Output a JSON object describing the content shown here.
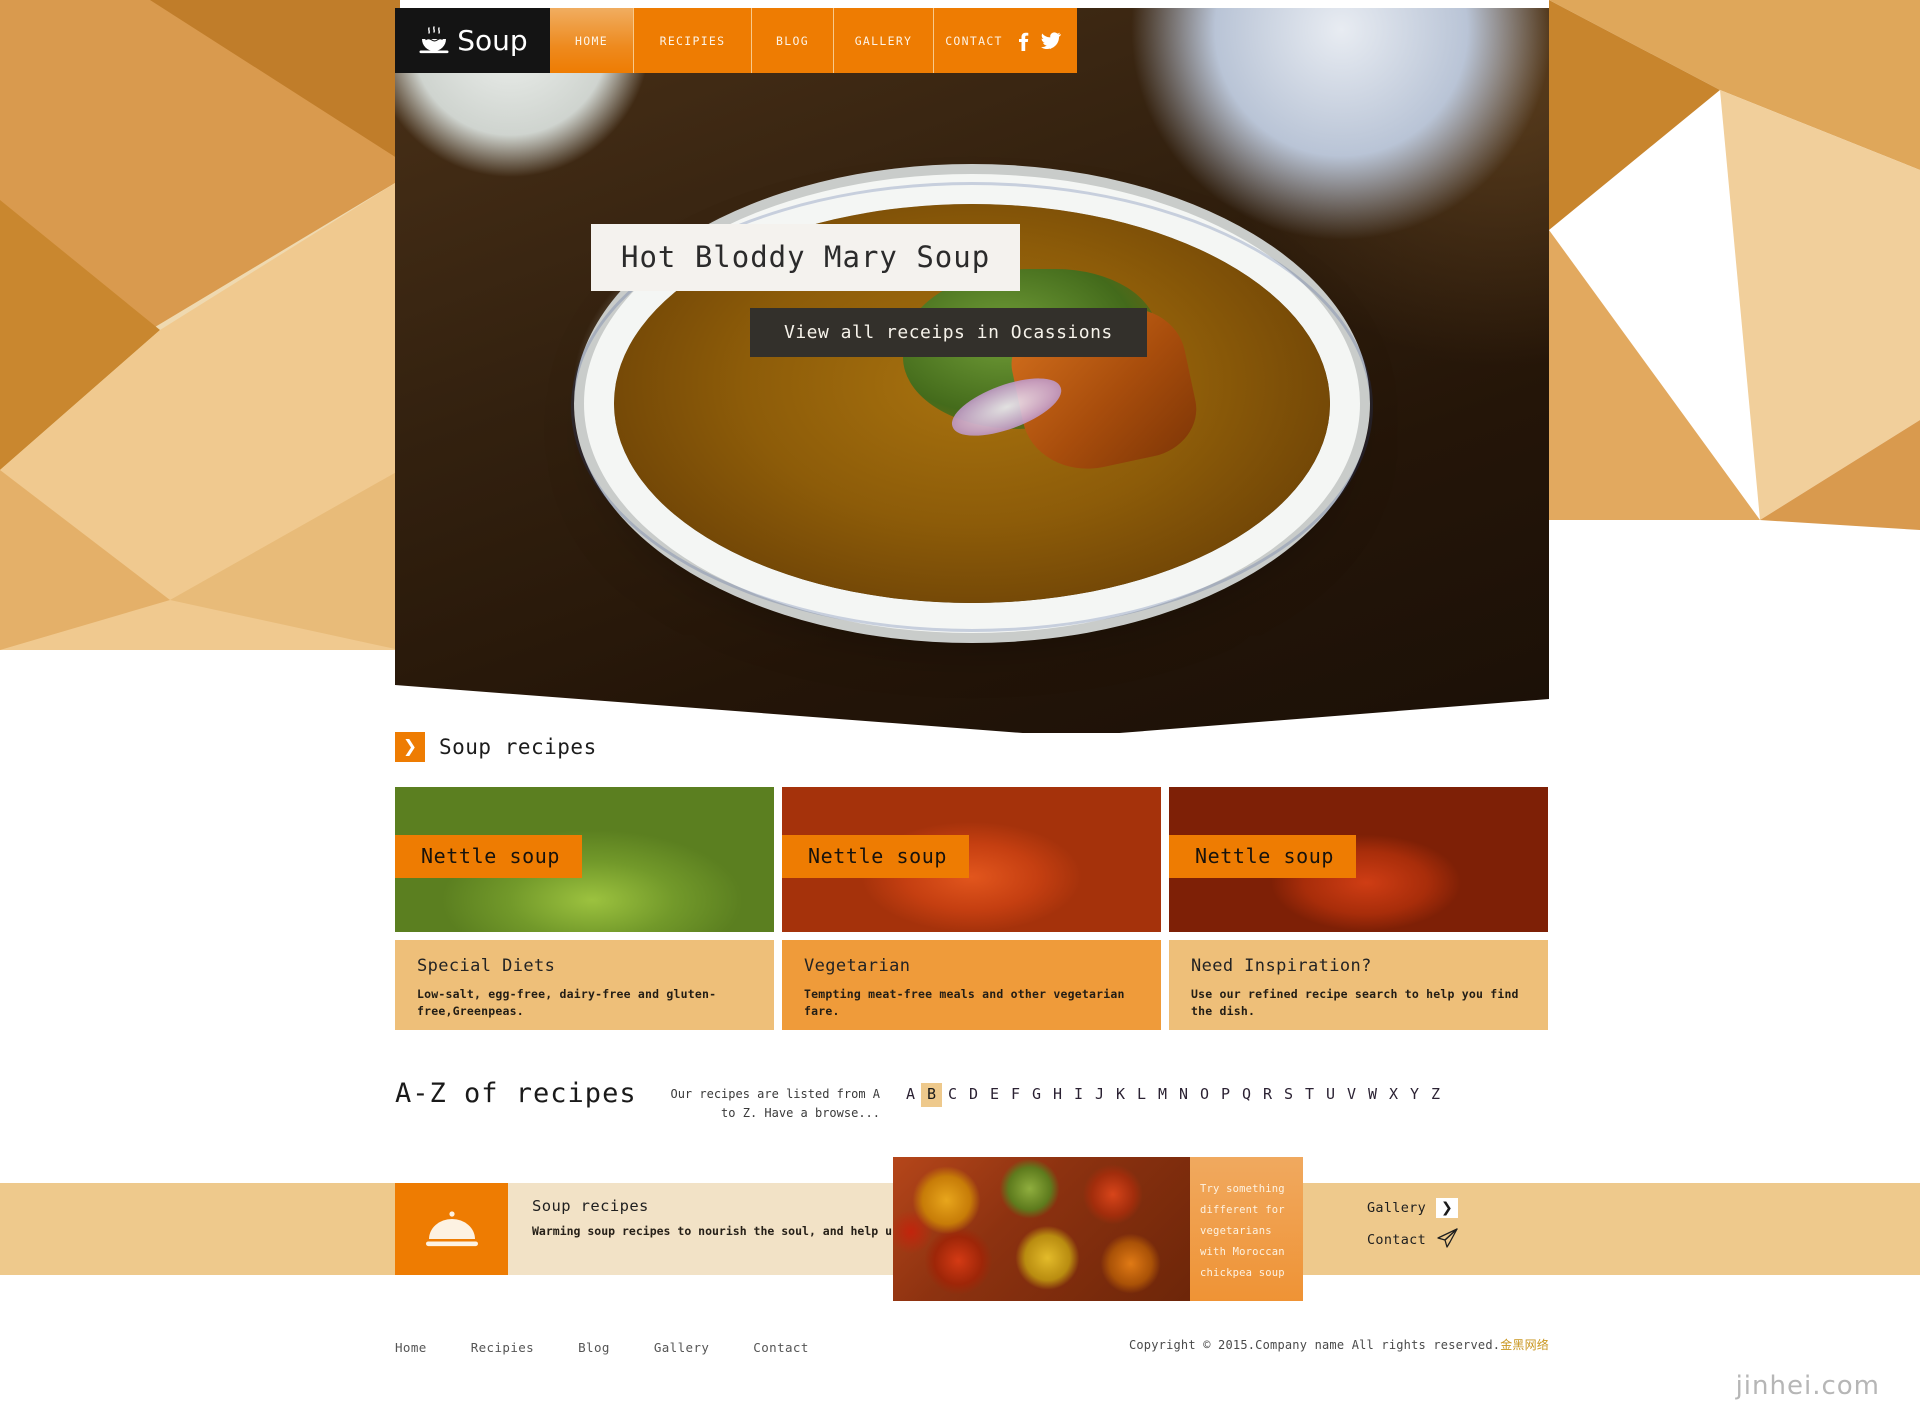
{
  "brand": {
    "name": "Soup",
    "icon": "soup-bowl-icon"
  },
  "nav": {
    "items": [
      {
        "label": "HOME",
        "key": "home"
      },
      {
        "label": "RECIPIES",
        "key": "recipies"
      },
      {
        "label": "BLOG",
        "key": "blog"
      },
      {
        "label": "GALLERY",
        "key": "gallery"
      },
      {
        "label": "CONTACT",
        "key": "contact"
      }
    ],
    "social": [
      {
        "name": "facebook-icon",
        "glyph": "f"
      },
      {
        "name": "twitter-icon",
        "glyph": "bird"
      }
    ]
  },
  "hero": {
    "title": "Hot Bloddy Mary Soup",
    "button": "View all receips in Ocassions"
  },
  "section": {
    "heading": "Soup recipes",
    "arrow_icon": "chevron-right-icon"
  },
  "cards": [
    {
      "label": "Nettle soup"
    },
    {
      "label": "Nettle soup"
    },
    {
      "label": "Nettle soup"
    }
  ],
  "infos": [
    {
      "title": "Special Diets",
      "text": "Low-salt, egg-free, dairy-free and gluten-free,Greenpeas."
    },
    {
      "title": "Vegetarian",
      "text": "Tempting meat-free meals and other vegetarian fare."
    },
    {
      "title": "Need Inspiration?",
      "text": "Use our refined recipe search to help you find the dish."
    }
  ],
  "az": {
    "title": "A-Z of recipes",
    "note": "Our recipes are listed from A to Z. Have a browse...",
    "letters": [
      "A",
      "B",
      "C",
      "D",
      "E",
      "F",
      "G",
      "H",
      "I",
      "J",
      "K",
      "L",
      "M",
      "N",
      "O",
      "P",
      "Q",
      "R",
      "S",
      "T",
      "U",
      "V",
      "W",
      "X",
      "Y",
      "Z"
    ],
    "active_letter": "B"
  },
  "promo": {
    "icon": "food-cloche-icon",
    "title": "Soup recipes",
    "text": "Warming soup recipes to nourish the soul, and help use up all those extra vegetables lurking in your fridge crisper.",
    "caption": "Try something different for vegetarians with Moroccan chickpea soup",
    "links": [
      {
        "label": "Gallery",
        "icon": "chevron-right-icon"
      },
      {
        "label": "Contact",
        "icon": "paper-plane-icon"
      }
    ]
  },
  "footer": {
    "links": [
      "Home",
      "Recipies",
      "Blog",
      "Gallery",
      "Contact"
    ],
    "copyright": "Copyright © 2015.Company name All rights reserved.",
    "copyright_cn": "金黑网络",
    "watermark": "jinhei.com"
  },
  "colors": {
    "orange": "#ee7c02",
    "tan": "#eec98c",
    "dark": "#141414",
    "cream": "#f2e2c6"
  }
}
